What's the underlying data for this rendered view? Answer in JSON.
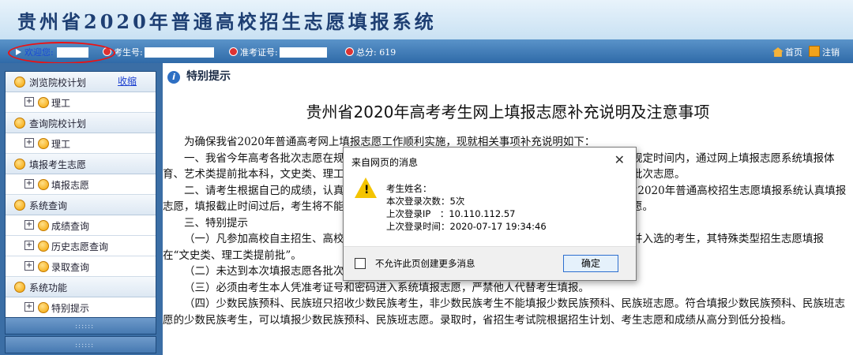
{
  "header": {
    "title": "贵州省2020年普通高校招生志愿填报系统"
  },
  "infobar": {
    "welcome_label": "欢迎您:",
    "exam_no_label": "考生号:",
    "admission_no_label": "准考证号:",
    "total_score_label": "总分:",
    "total_score_value": "619",
    "home_link": "首页",
    "logout_link": "注销"
  },
  "sidebar": {
    "collapse_label": "收缩",
    "sections": [
      {
        "label": "浏览院校计划",
        "items": [
          "理工"
        ]
      },
      {
        "label": "查询院校计划",
        "items": [
          "理工"
        ]
      },
      {
        "label": "填报考生志愿",
        "items": [
          "填报志愿"
        ]
      },
      {
        "label": "系统查询",
        "items": [
          "成绩查询",
          "历史志愿查询",
          "录取查询"
        ]
      },
      {
        "label": "系统功能",
        "items": [
          "特别提示"
        ]
      }
    ],
    "footer_dots": "::::::"
  },
  "main": {
    "notice_title": "特别提示",
    "doc_title": "贵州省2020年高考考生网上填报志愿补充说明及注意事项",
    "paragraphs": [
      "为确保我省2020年普通高考网上填报志愿工作顺利实施，现就相关事项补充说明如下：",
      "一、我省今年高考各批次志愿在规定时间（以各批次志愿填报时间为准）之间填报。考生必须在规定时间内，通过网上填报志愿系统填报体育、艺术类提前批本科，文史类、理工类提前批本科、第一批本科、第二批本科、高职（专科）等各批次志愿。",
      "二、请考生根据自己的成绩，认真阅读《贵州省2020年普通高校招生录取规定》后，登录贵州省2020年普通高校招生志愿填报系统认真填报志愿，填报截止时间过后，考生将不能再填报志愿。请广大考生合理安排填报志愿时间并及时提交志愿。",
      "三、特别提示",
      "（一）凡参加高校自主招生、高校专项计划、高水平艺术团、高水平运动队等特殊类型招生测试并入选的考生，其特殊类型招生志愿填报在“文史类、理工类提前批”。",
      "（二）未达到本次填报志愿各批次最低分数线要求的考生填报的志愿无效。",
      "（三）必须由考生本人凭准考证号和密码进入系统填报志愿，严禁他人代替考生填报。",
      "（四）少数民族预科、民族班只招收少数民族考生，非少数民族考生不能填报少数民族预科、民族班志愿。符合填报少数民族预科、民族班志愿的少数民族考生，可以填报少数民族预科、民族班志愿。录取时，省招生考试院根据招生计划、考生志愿和成绩从高分到低分投档。"
    ]
  },
  "dialog": {
    "title": "来自网页的消息",
    "close_glyph": "✕",
    "lines": [
      "考生姓名：",
      "本次登录次数：5次",
      "上次登录IP　：10.110.112.57",
      "上次登录时间：2020-07-17 19:34:46"
    ],
    "checkbox_label": "不允许此页创建更多消息",
    "ok_label": "确定"
  }
}
